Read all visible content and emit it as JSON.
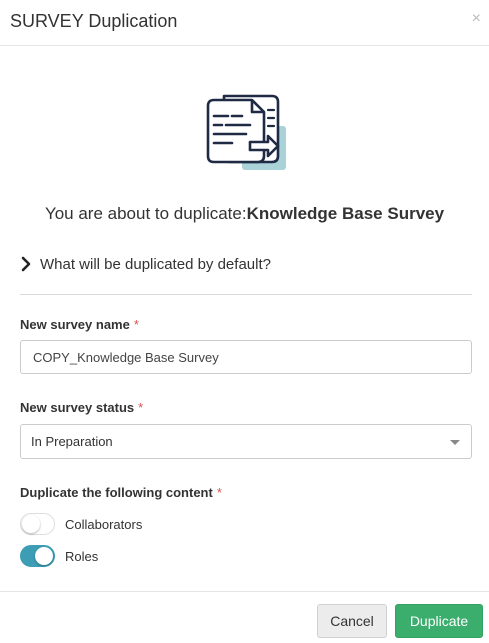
{
  "dialog": {
    "title": "SURVEY Duplication",
    "close_glyph": "×"
  },
  "illustration": {
    "icon": "duplicate-document-icon",
    "colors": {
      "stroke": "#1f2a44",
      "accent": "#a9d3d9"
    }
  },
  "headline": {
    "prefix": "You are about to duplicate:",
    "survey_name": "Knowledge Base Survey"
  },
  "details": {
    "label": "What will be duplicated by default?"
  },
  "form": {
    "name_label": "New survey name",
    "required_mark": "*",
    "name_value": "COPY_Knowledge Base Survey",
    "status_label": "New survey status",
    "status_value": "In Preparation",
    "content_label": "Duplicate the following content",
    "toggles": [
      {
        "label": "Collaborators",
        "checked": false
      },
      {
        "label": "Roles",
        "checked": true
      }
    ]
  },
  "footer": {
    "cancel_label": "Cancel",
    "duplicate_label": "Duplicate"
  },
  "colors": {
    "primary": "#3bae6e",
    "toggle_on": "#3c9db5",
    "required": "#d9534f"
  }
}
